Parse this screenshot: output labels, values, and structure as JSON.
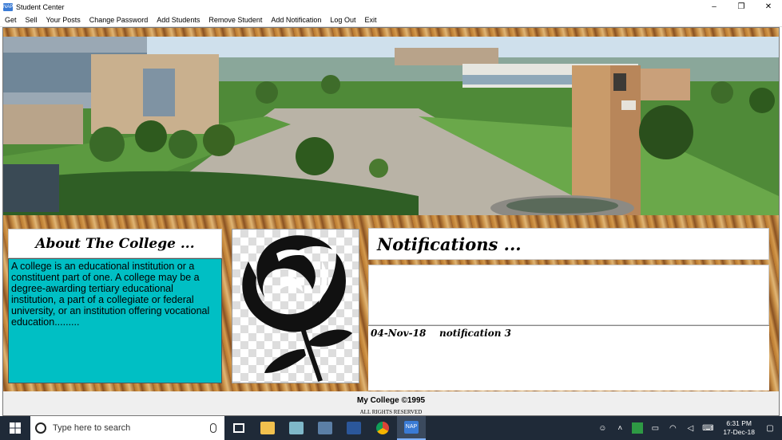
{
  "window": {
    "title": "Student Center",
    "app_icon_text": "NAP",
    "controls": {
      "minimize": "–",
      "maximize": "❐",
      "close": "✕"
    }
  },
  "menu": {
    "items": [
      "Get",
      "Sell",
      "Your Posts",
      "Change Password",
      "Add Students",
      "Remove Student",
      "Add Notification",
      "Log Out",
      "Exit"
    ]
  },
  "about": {
    "title": "About The College ...",
    "body": "A college is an educational institution or a constituent part of one. A college may be a degree-awarding tertiary educational institution, a part of a collegiate or federal university, or an  institution offering vocational education........."
  },
  "notifications": {
    "title": "Notifications ...",
    "items": [
      {
        "date": "04-Nov-18",
        "text": "notification 3"
      }
    ]
  },
  "footer": {
    "main": "My College ©1995",
    "sub": "ALL RIGHTS RESERVED"
  },
  "taskbar": {
    "search_placeholder": "Type here to search",
    "apps": [
      "task-view",
      "file-explorer",
      "notepad",
      "network-app",
      "word",
      "chrome",
      "nap-app"
    ],
    "time": "6:31 PM",
    "date": "17-Dec-18",
    "active_app_label": "NAP"
  },
  "colors": {
    "about_bg": "#00bfc4",
    "taskbar_bg": "#1f2a38",
    "wood": "#b8782e"
  }
}
